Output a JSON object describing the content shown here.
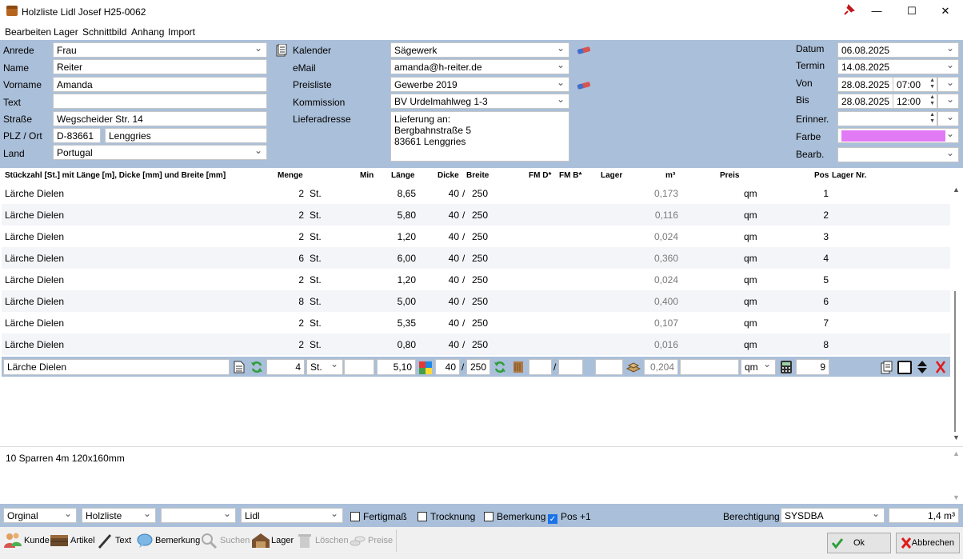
{
  "window": {
    "title": "Holzliste Lidl Josef H25-0062",
    "close_glyph": "✕",
    "max_glyph": "☐",
    "min_glyph": "—"
  },
  "menu": [
    "Bearbeiten",
    "Lager",
    "Schnittbild",
    "Anhang",
    "Import"
  ],
  "left_form": {
    "anrede_label": "Anrede",
    "anrede": "Frau",
    "name_label": "Name",
    "name": "Reiter",
    "vorname_label": "Vorname",
    "vorname": "Amanda",
    "text_label": "Text",
    "text": "",
    "strasse_label": "Straße",
    "strasse": "Wegscheider Str. 14",
    "plzort_label": "PLZ / Ort",
    "plz": "D-83661",
    "ort": "Lenggries",
    "land_label": "Land",
    "land": "Portugal"
  },
  "mid_form": {
    "kalender_label": "Kalender",
    "kalender": "Sägewerk",
    "email_label": "eMail",
    "email": "amanda@h-reiter.de",
    "preisliste_label": "Preisliste",
    "preisliste": "Gewerbe 2019",
    "kommission_label": "Kommission",
    "kommission": "BV Urdelmahlweg 1-3",
    "lieferadresse_label": "Lieferadresse",
    "lieferadresse_l1": "Lieferung an:",
    "lieferadresse_l2": "Bergbahnstraße 5",
    "lieferadresse_l3": "83661 Lenggries"
  },
  "right_form": {
    "datum_label": "Datum",
    "datum": "06.08.2025",
    "termin_label": "Termin",
    "termin": "14.08.2025",
    "von_label": "Von",
    "von_date": "28.08.2025",
    "von_time": "07:00",
    "bis_label": "Bis",
    "bis_date": "28.08.2025",
    "bis_time": "12:00",
    "erinner_label": "Erinner.",
    "farbe_label": "Farbe",
    "farbe_color": "#e27af5",
    "bearb_label": "Bearb."
  },
  "grid": {
    "headers": {
      "desc": "Stückzahl [St.] mit Länge [m], Dicke [mm] und Breite [mm]",
      "menge": "Menge",
      "min": "Min",
      "laenge": "Länge",
      "dicke": "Dicke",
      "breite": "Breite",
      "fmd": "FM D*",
      "fmb": "FM B*",
      "lager": "Lager",
      "m3": "m³",
      "preis": "Preis",
      "pos": "Pos",
      "lagernr": "Lager Nr."
    },
    "rows": [
      {
        "desc": "Lärche Dielen",
        "menge": "2",
        "unit": "St.",
        "laenge": "8,65",
        "dicke": "40",
        "sep": "/",
        "breite": "250",
        "m3": "0,173",
        "preis": "qm",
        "pos": "1"
      },
      {
        "desc": "Lärche Dielen",
        "menge": "2",
        "unit": "St.",
        "laenge": "5,80",
        "dicke": "40",
        "sep": "/",
        "breite": "250",
        "m3": "0,116",
        "preis": "qm",
        "pos": "2"
      },
      {
        "desc": "Lärche Dielen",
        "menge": "2",
        "unit": "St.",
        "laenge": "1,20",
        "dicke": "40",
        "sep": "/",
        "breite": "250",
        "m3": "0,024",
        "preis": "qm",
        "pos": "3"
      },
      {
        "desc": "Lärche Dielen",
        "menge": "6",
        "unit": "St.",
        "laenge": "6,00",
        "dicke": "40",
        "sep": "/",
        "breite": "250",
        "m3": "0,360",
        "preis": "qm",
        "pos": "4"
      },
      {
        "desc": "Lärche Dielen",
        "menge": "2",
        "unit": "St.",
        "laenge": "1,20",
        "dicke": "40",
        "sep": "/",
        "breite": "250",
        "m3": "0,024",
        "preis": "qm",
        "pos": "5"
      },
      {
        "desc": "Lärche Dielen",
        "menge": "8",
        "unit": "St.",
        "laenge": "5,00",
        "dicke": "40",
        "sep": "/",
        "breite": "250",
        "m3": "0,400",
        "preis": "qm",
        "pos": "6"
      },
      {
        "desc": "Lärche Dielen",
        "menge": "2",
        "unit": "St.",
        "laenge": "5,35",
        "dicke": "40",
        "sep": "/",
        "breite": "250",
        "m3": "0,107",
        "preis": "qm",
        "pos": "7"
      },
      {
        "desc": "Lärche Dielen",
        "menge": "2",
        "unit": "St.",
        "laenge": "0,80",
        "dicke": "40",
        "sep": "/",
        "breite": "250",
        "m3": "0,016",
        "preis": "qm",
        "pos": "8"
      }
    ],
    "edit": {
      "desc": "Lärche Dielen",
      "menge": "4",
      "unit": "St.",
      "laenge": "5,10",
      "dicke": "40",
      "sep": "/",
      "breite": "250",
      "fm_sep": "/",
      "m3": "0,204",
      "preis": "qm",
      "pos": "9"
    }
  },
  "notes": "10 Sparren 4m 120x160mm",
  "bottom": {
    "dd1": "Orginal",
    "dd2": "Holzliste",
    "dd3": "",
    "dd4": "Lidl",
    "fertigmass": "Fertigmaß",
    "trocknung": "Trocknung",
    "bemerkung": "Bemerkung",
    "pos1": "Pos +1",
    "check_glyph": "✓",
    "berechtigung_label": "Berechtigung",
    "berechtigung": "SYSDBA",
    "total": "1,4 m³"
  },
  "toolbar": {
    "kunde": "Kunde",
    "artikel": "Artikel",
    "text": "Text",
    "bemerkung": "Bemerkung",
    "suchen": "Suchen",
    "lager": "Lager",
    "loeschen": "Löschen",
    "preise": "Preise",
    "ok": "Ok",
    "abbrechen": "Abbrechen"
  }
}
